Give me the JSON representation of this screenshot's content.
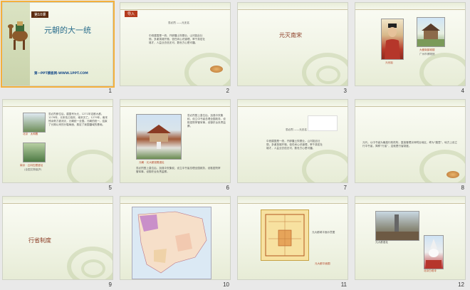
{
  "slides": [
    {
      "num": "1",
      "tag": "第10课",
      "title": "元朝的大一统",
      "footer": "第一PPT模板网-WWW.1PPT.COM"
    },
    {
      "num": "2",
      "tag": "导入",
      "poem_title": "忽必烈  ——元无名",
      "poem": "中统建国是一统，开辟疆土恢基业。山河如此壮丽，多谢英雄开驰，信任尚心识道理，率千英宏壮雄才，人益业去信无可，数世方心是可疆。"
    },
    {
      "num": "3",
      "center_title": "元灭南宋"
    },
    {
      "num": "4",
      "cap_left": "元世祖",
      "cap_right": "大都南镇城楼",
      "cap_right2": "广州市博物馆"
    },
    {
      "num": "5",
      "cap_top": "北京 · 太和殿",
      "cap_bottom": "南京 · 云冈石窟遗址",
      "cap_bottom2": "(全国文物保护)",
      "para": "忽必烈即位后，建国号为元，1271年定都大都。1276年，元军攻占临安，南宋灭亡。1279年，南宋残余势力被消灭，元朝统一全国。元朝的统一，结束了长期以来的分裂局面，奠定了我国疆域的基础。"
    },
    {
      "num": "6",
      "cap": "元朝 · 元大都宫殿遗址",
      "para": "忽必烈登上皇位后，加强中央集权，设立中书省总理全国政务，设枢密院掌管军事，设御史台负责监察。"
    },
    {
      "num": "7",
      "poem_title": "忽必烈  ——元无名",
      "poem": "中统建国是一统，开辟疆土恢基业。山河如此壮丽，多谢英雄开驰，信任尚心识道理，率千英宏壮雄才，人益业去信无可，数世方心是可疆。"
    },
    {
      "num": "8",
      "para": "元代，以中书省为最高行政机构，直接管理京师附近地区，称为“腹里”。地方上设立行中书省，简称“行省”，这就是行省制度。"
    },
    {
      "num": "9",
      "center_title": "行省制度"
    },
    {
      "num": "10"
    },
    {
      "num": "11",
      "side": "元大都城平面示意图",
      "cap": "元大都平面图"
    },
    {
      "num": "12",
      "cap_left": "元大都遗址",
      "cap_right": "北京白塔寺"
    }
  ],
  "colors": {
    "accent": "#b43b1e",
    "selected": "#f4b03c",
    "bg": "#e9e9e9"
  }
}
